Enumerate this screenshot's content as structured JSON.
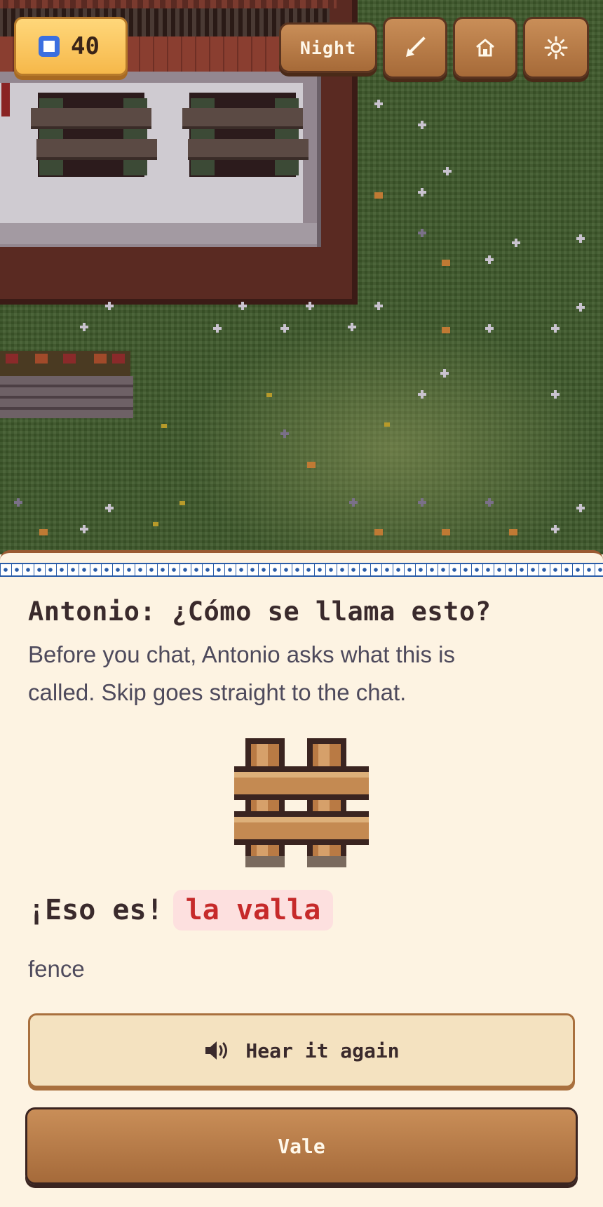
{
  "hud": {
    "coin_count": "40",
    "coin_icon": "square-coin-icon",
    "night_label": "Night",
    "tool_icon": "shovel-icon",
    "home_icon": "home-icon",
    "settings_icon": "sun-gear-icon"
  },
  "dialog": {
    "title": "Antonio: ¿Cómo se llama esto?",
    "description": "Before you chat, Antonio asks what this is called. Skip goes straight to the chat.",
    "item_icon": "wooden-fence-icon",
    "answer_exclaim": "¡Eso es!",
    "answer_word": "la valla",
    "translation": "fence",
    "hear_again_label": "Hear it again",
    "hear_icon": "speaker-icon",
    "ok_label": "Vale"
  },
  "colors": {
    "accent_button": "#b87a46",
    "answer_highlight": "#c62a2a",
    "coin_blue": "#3b6fe0",
    "panel_bg": "#fdf3e2"
  }
}
